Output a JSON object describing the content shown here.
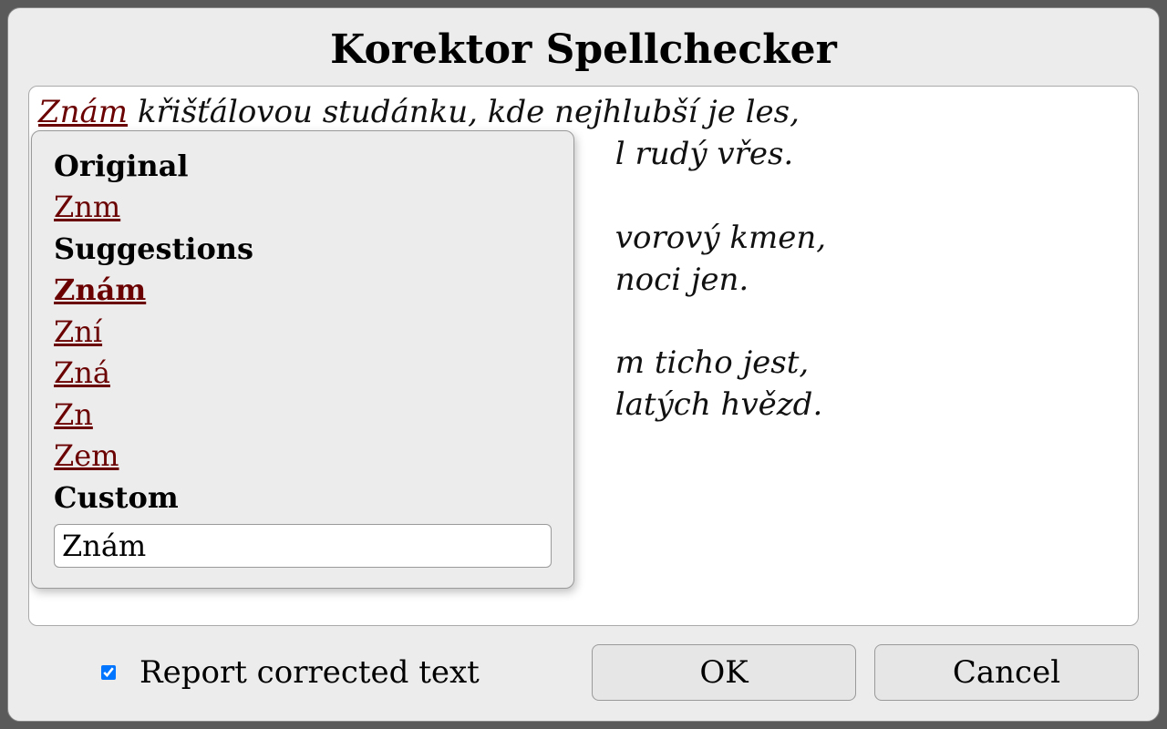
{
  "dialog": {
    "title": "Korektor Spellchecker"
  },
  "text": {
    "misspelled_word": "Znám",
    "line1_rest": " křišťálovou studánku, kde nejhlubší je les,",
    "line2_tail": "l rudý vřes.",
    "line4_tail": "vorový kmen,",
    "line5_tail": "noci jen.",
    "line7_tail": "m ticho jest,",
    "line8_tail": "latých hvězd."
  },
  "popup": {
    "original_label": "Original",
    "original_value": "Znm",
    "suggestions_label": "Suggestions",
    "suggestions": [
      "Znám",
      "Zní",
      "Zná",
      "Zn",
      "Zem"
    ],
    "selected_index": 0,
    "custom_label": "Custom",
    "custom_value": "Znám"
  },
  "footer": {
    "report_label": "Report corrected text",
    "report_checked": true,
    "ok_label": "OK",
    "cancel_label": "Cancel"
  }
}
